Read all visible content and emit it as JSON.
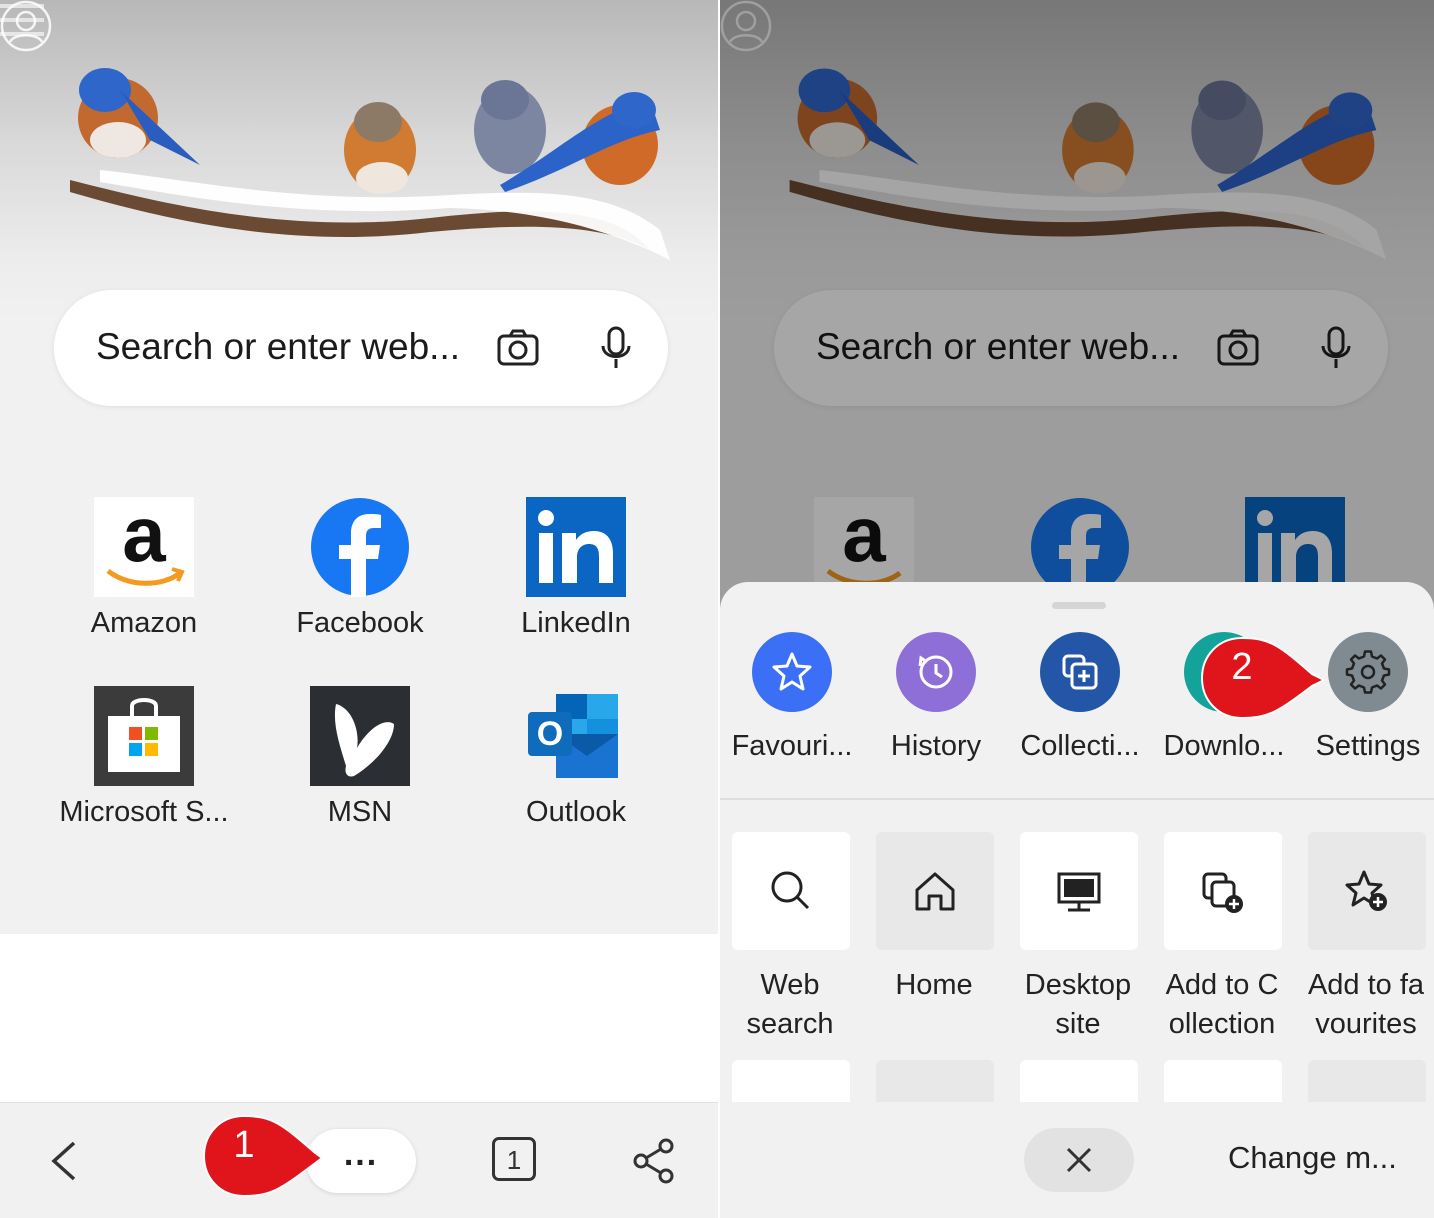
{
  "left_screen": {
    "search": {
      "placeholder": "Search or enter web..."
    },
    "tiles": [
      {
        "label": "Amazon",
        "icon": "amazon-icon"
      },
      {
        "label": "Facebook",
        "icon": "facebook-icon"
      },
      {
        "label": "LinkedIn",
        "icon": "linkedin-icon"
      },
      {
        "label": "Microsoft S...",
        "icon": "microsoft-store-icon"
      },
      {
        "label": "MSN",
        "icon": "msn-icon"
      },
      {
        "label": "Outlook",
        "icon": "outlook-icon"
      }
    ],
    "bottom_bar": {
      "more_label": "...",
      "tab_count": "1"
    },
    "callout_number": "1"
  },
  "right_screen": {
    "search": {
      "placeholder": "Search or enter web..."
    },
    "menu_circles": [
      {
        "label": "Favouri...",
        "icon": "star-icon",
        "color": "#3b6ff5"
      },
      {
        "label": "History",
        "icon": "history-icon",
        "color": "#8e6fd8"
      },
      {
        "label": "Collecti...",
        "icon": "collections-icon",
        "color": "#2456a8"
      },
      {
        "label": "Downlo...",
        "icon": "download-icon",
        "color": "#14a39a"
      },
      {
        "label": "Settings",
        "icon": "gear-icon",
        "color": "#7f8b91"
      }
    ],
    "menu_tiles": [
      {
        "label_line1": "Web",
        "label_line2": "search",
        "icon": "search-icon"
      },
      {
        "label_line1": "Home",
        "label_line2": "",
        "icon": "home-icon"
      },
      {
        "label_line1": "Desktop",
        "label_line2": "site",
        "icon": "desktop-icon"
      },
      {
        "label_line1": "Add to C",
        "label_line2": "ollection",
        "icon": "add-collection-icon"
      },
      {
        "label_line1": "Add to fa",
        "label_line2": "vourites",
        "icon": "add-favourite-icon"
      }
    ],
    "bottom": {
      "change_mode": "Change m..."
    },
    "callout_number": "2"
  },
  "colors": {
    "callout_red": "#e0141b",
    "linkedin_blue": "#0a66c2",
    "facebook_blue": "#1877f2"
  }
}
